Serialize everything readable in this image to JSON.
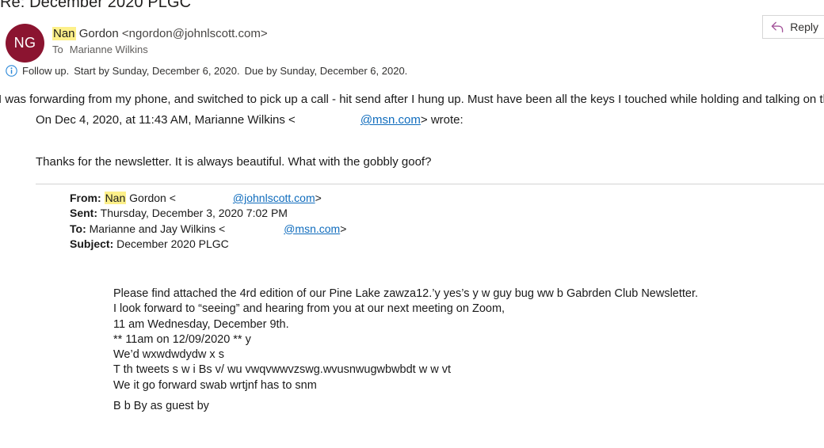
{
  "window": {
    "subject": "Re: December 2020 PLGC"
  },
  "toolbar": {
    "reply_label": "Reply",
    "reply_icon": "reply-arrow-icon",
    "reply_icon_color": "#a4549a"
  },
  "message_header": {
    "avatar_initials": "NG",
    "avatar_color": "#8b1430",
    "sender_first_name": "Nan",
    "sender_last_name": " Gordon ",
    "sender_email": "<ngordon@johnlscott.com>",
    "to_label": "To",
    "to_recipients": "Marianne Wilkins",
    "highlight_color": "#fdf08a"
  },
  "followup": {
    "icon": "info-circle-icon",
    "icon_color": "#0f6cbd",
    "label": "Follow up.",
    "start_by": "Start by Sunday, December 6, 2020.",
    "due_by": "Due by Sunday, December 6, 2020."
  },
  "body": {
    "line_1": "I was forwarding from my phone, and switched to pick up a call - hit send after I hung up. Must have been all the keys I touched while holding and talking on the phone call!",
    "quote_intro_prefix": "On Dec 4, 2020, at 11:43 AM, Marianne Wilkins <",
    "quote_intro_link": "@msn.com",
    "quote_intro_suffix": "> wrote:",
    "quote_thanks": "Thanks for the newsletter.  It is always beautiful.   What with the gobbly goof?"
  },
  "quoted_header": {
    "from_label": "From:",
    "from_name_highlight": "Nan",
    "from_name_rest": " Gordon  <",
    "from_link": "@johnlscott.com",
    "from_suffix": ">",
    "sent_label": "Sent:",
    "sent_value": "Thursday, December 3, 2020 7:02 PM",
    "to_label": "To:",
    "to_value": "Marianne and Jay Wilkins  <",
    "to_link": "@msn.com",
    "to_suffix": ">",
    "subject_label": "Subject:",
    "subject_value": "December 2020 PLGC"
  },
  "newsletter": {
    "lines": [
      "Please find attached the 4rd edition of our Pine Lake zawza12.’y yes’s y w guy bug ww b Gabrden Club Newsletter.",
      "I look forward to “seeing” and hearing from you at our next meeting on Zoom,",
      "11 am Wednesday, December 9th.",
      " **  11am on 12/09/2020  ** y",
      " We’d wxwdwdydw  x s",
      "T th tweets s w i  Bs v/ wu vwqvwwvzswg.wvusnwugwbwbdt w w vt",
      " We it go forward swab wrtjnf has to snm"
    ],
    "closing_line": "B b  By as guest  by"
  },
  "colors": {
    "link": "#0f6cbd",
    "divider": "#d3d3d3",
    "text": "#1a1a1a"
  }
}
